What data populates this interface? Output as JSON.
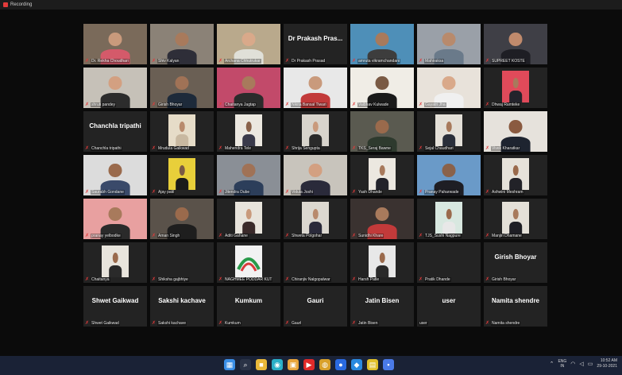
{
  "recording": {
    "label": "Recording"
  },
  "participants": [
    {
      "name": "Dr. Rekha Choudhari",
      "kind": "video",
      "bg": "#7a6a5a",
      "skin": "#c99a7c",
      "shirt": "#d45a6a"
    },
    {
      "name": "Shiv Kalyan",
      "kind": "video",
      "bg": "#8b8277",
      "skin": "#a87a5c",
      "shirt": "#2e2e38"
    },
    {
      "name": "Archana Chhutrukar",
      "kind": "video",
      "bg": "#b9a98c",
      "skin": "#d9a98a",
      "shirt": "#e0e0d8"
    },
    {
      "name": "Dr Prakash Prasad",
      "kind": "avatar",
      "display": "Dr Prakash Pras..."
    },
    {
      "name": "amruta vikramchandani",
      "kind": "video",
      "bg": "#4e8fb8",
      "skin": "#a87a5c",
      "shirt": "#3d3d3d"
    },
    {
      "name": "Mahiraksa",
      "kind": "video",
      "bg": "#9aa0a8",
      "skin": "#b88a6c",
      "shirt": "#6a7a8a",
      "active": true
    },
    {
      "name": "SUPREET KOSTE",
      "kind": "video",
      "bg": "#3f3f46",
      "skin": "#c08a6c",
      "shirt": "#1e1e24"
    },
    {
      "name": "shruti pandey",
      "kind": "video",
      "bg": "#c6c1b8",
      "skin": "#d3a081",
      "shirt": "#2c2c2c"
    },
    {
      "name": "Girish Bhoyar",
      "kind": "video",
      "bg": "#6a5f54",
      "skin": "#a07256",
      "shirt": "#1d2a3a"
    },
    {
      "name": "Chaitanya Jagtap",
      "kind": "video",
      "bg": "#c24a6a",
      "skin": "#a87a5c",
      "shirt": "#2b2b2b"
    },
    {
      "name": "Nikita Bansal Tiwari",
      "kind": "video",
      "bg": "#e8e8e8",
      "skin": "#c99a7c",
      "shirt": "#c23a3a"
    },
    {
      "name": "Vaibhav Kulwade",
      "kind": "video",
      "bg": "#f0ede6",
      "skin": "#7a5a44",
      "shirt": "#1a1a1a"
    },
    {
      "name": "Gayatri Jha",
      "kind": "video",
      "bg": "#e8e2da",
      "skin": "#d9a98a",
      "shirt": "#f0f0f0"
    },
    {
      "name": "Dhwaj Ramteke",
      "kind": "small",
      "bg": "#e04a5a",
      "skin": "#a87a5c",
      "shirt": "#23232b"
    },
    {
      "name": "Chanchla tripathi",
      "kind": "avatar",
      "display": "Chanchla tripathi"
    },
    {
      "name": "Mrudula Gaikwad",
      "kind": "small",
      "bg": "#e6dcc8",
      "skin": "#b88a6c",
      "shirt": "#c8b8a0"
    },
    {
      "name": "Mahendra Tele",
      "kind": "small",
      "bg": "#ece8e0",
      "skin": "#8a624a",
      "shirt": "#3a3a4a"
    },
    {
      "name": "Shrija Sengupta",
      "kind": "small",
      "bg": "#d8d4cc",
      "skin": "#c99a7c",
      "shirt": "#2a2a2a"
    },
    {
      "name": "TKS_Seraj Bawne",
      "kind": "video",
      "bg": "#5a5a50",
      "skin": "#9a6a4c",
      "shirt": "#2e3a2e"
    },
    {
      "name": "Sejal Chaudhari",
      "kind": "small",
      "bg": "#e4e0d8",
      "skin": "#a87a5c",
      "shirt": "#2a2f3a"
    },
    {
      "name": "Vivek Kharatkar",
      "kind": "video",
      "bg": "#e6e2dc",
      "skin": "#8a5a40",
      "shirt": "#1e2430"
    },
    {
      "name": "Saurabh Gondane",
      "kind": "video",
      "bg": "#dcdcdc",
      "skin": "#9a6a4c",
      "shirt": "#3a4a6a"
    },
    {
      "name": "Ajay patil",
      "kind": "small",
      "bg": "#e8cf3a",
      "skin": "#7a5a44",
      "shirt": "#1a1a1a"
    },
    {
      "name": "Jitendra Dube",
      "kind": "video",
      "bg": "#8a8f96",
      "skin": "#a07256",
      "shirt": "#2c3e5a"
    },
    {
      "name": "Vidula Joshi",
      "kind": "video",
      "bg": "#c8c4bc",
      "skin": "#d3a081",
      "shirt": "#2a2a3a"
    },
    {
      "name": "Yash Dhande",
      "kind": "small",
      "bg": "#ece8e0",
      "skin": "#a87a5c",
      "shirt": "#22222a"
    },
    {
      "name": "Pranay Paharwade",
      "kind": "video",
      "bg": "#6a9ac8",
      "skin": "#8a624a",
      "shirt": "#1e1e24"
    },
    {
      "name": "Ashwini Meshram",
      "kind": "small",
      "bg": "#e6e2da",
      "skin": "#9a6a4c",
      "shirt": "#222228"
    },
    {
      "name": "pranay yelbodke",
      "kind": "video",
      "bg": "#e8a0a0",
      "skin": "#a87a5c",
      "shirt": "#2a2a2a"
    },
    {
      "name": "Aman Singh",
      "kind": "video",
      "bg": "#5a524a",
      "skin": "#9a6a4c",
      "shirt": "#1e1e1e"
    },
    {
      "name": "Aditi Gahane",
      "kind": "small",
      "bg": "#e8e4dc",
      "skin": "#c99a7c",
      "shirt": "#3a2a2a"
    },
    {
      "name": "Shweta Polgohar",
      "kind": "small",
      "bg": "#dcd8d0",
      "skin": "#b88a6c",
      "shirt": "#2a2a3a"
    },
    {
      "name": "Sunidhi Khare",
      "kind": "video",
      "bg": "#3a3230",
      "skin": "#a87a5c",
      "shirt": "#c23a3a"
    },
    {
      "name": "TJS_Sushi Nagpure",
      "kind": "small",
      "bg": "#d8e8e0",
      "skin": "#9a6a4c",
      "shirt": "#e8e8e8"
    },
    {
      "name": "Manjiri Dhamane",
      "kind": "small",
      "bg": "#e4e0d8",
      "skin": "#a87a5c",
      "shirt": "#1e1e24"
    },
    {
      "name": "Chaitanya",
      "kind": "small",
      "bg": "#e8e4dc",
      "skin": "#9a6a4c",
      "shirt": "#2a2a2a"
    },
    {
      "name": "Shiksha gajbhiye",
      "kind": "blank"
    },
    {
      "name": "NAGHMEE PODDAR KUT",
      "kind": "logo"
    },
    {
      "name": "Chiranjiv Nalgopalwar",
      "kind": "blank"
    },
    {
      "name": "Harsh Patle",
      "kind": "small",
      "bg": "#e8e8e8",
      "skin": "#9a6a4c",
      "shirt": "#2a2a2a"
    },
    {
      "name": "Pratik Dhande",
      "kind": "blank"
    },
    {
      "name": "Girish Bhoyar",
      "kind": "avatar",
      "display": "Girish Bhoyar"
    },
    {
      "name": "Shwet Gaikwad",
      "kind": "avatar",
      "display": "Shwet Gaikwad"
    },
    {
      "name": "Sakshi kachave",
      "kind": "avatar",
      "display": "Sakshi kachave"
    },
    {
      "name": "Kumkum",
      "kind": "avatar",
      "display": "Kumkum"
    },
    {
      "name": "Gaurl",
      "kind": "avatar",
      "display": "Gauri"
    },
    {
      "name": "Jatin Bisen",
      "kind": "avatar",
      "display": "Jatin Bisen"
    },
    {
      "name": "user",
      "kind": "avatar",
      "display": "user",
      "nomic": true
    },
    {
      "name": "Namita shendre",
      "kind": "avatar",
      "display": "Namita shendre"
    }
  ],
  "taskbar": {
    "icons": [
      {
        "name": "start-icon",
        "glyph": "▦",
        "color": "#3a8ee6"
      },
      {
        "name": "search-icon",
        "glyph": "⌕",
        "color": "#2a3346"
      },
      {
        "name": "file-explorer-icon",
        "glyph": "■",
        "color": "#e8b83a"
      },
      {
        "name": "edge-icon",
        "glyph": "◉",
        "color": "#2ab0c8"
      },
      {
        "name": "store-icon",
        "glyph": "▣",
        "color": "#e8a43a"
      },
      {
        "name": "youtube-icon",
        "glyph": "▶",
        "color": "#e02a2a"
      },
      {
        "name": "chrome-icon",
        "glyph": "◍",
        "color": "#d8a02a"
      },
      {
        "name": "zoom-icon",
        "glyph": "●",
        "color": "#2a6ae0"
      },
      {
        "name": "vscode-icon",
        "glyph": "◆",
        "color": "#2a8ae0"
      },
      {
        "name": "notes-icon",
        "glyph": "▤",
        "color": "#e0c02a"
      },
      {
        "name": "app-icon",
        "glyph": "▪",
        "color": "#4a7ae8"
      }
    ],
    "lang_top": "ENG",
    "lang_bottom": "IN",
    "time": "10:52 AM",
    "date": "29-10-2021"
  }
}
